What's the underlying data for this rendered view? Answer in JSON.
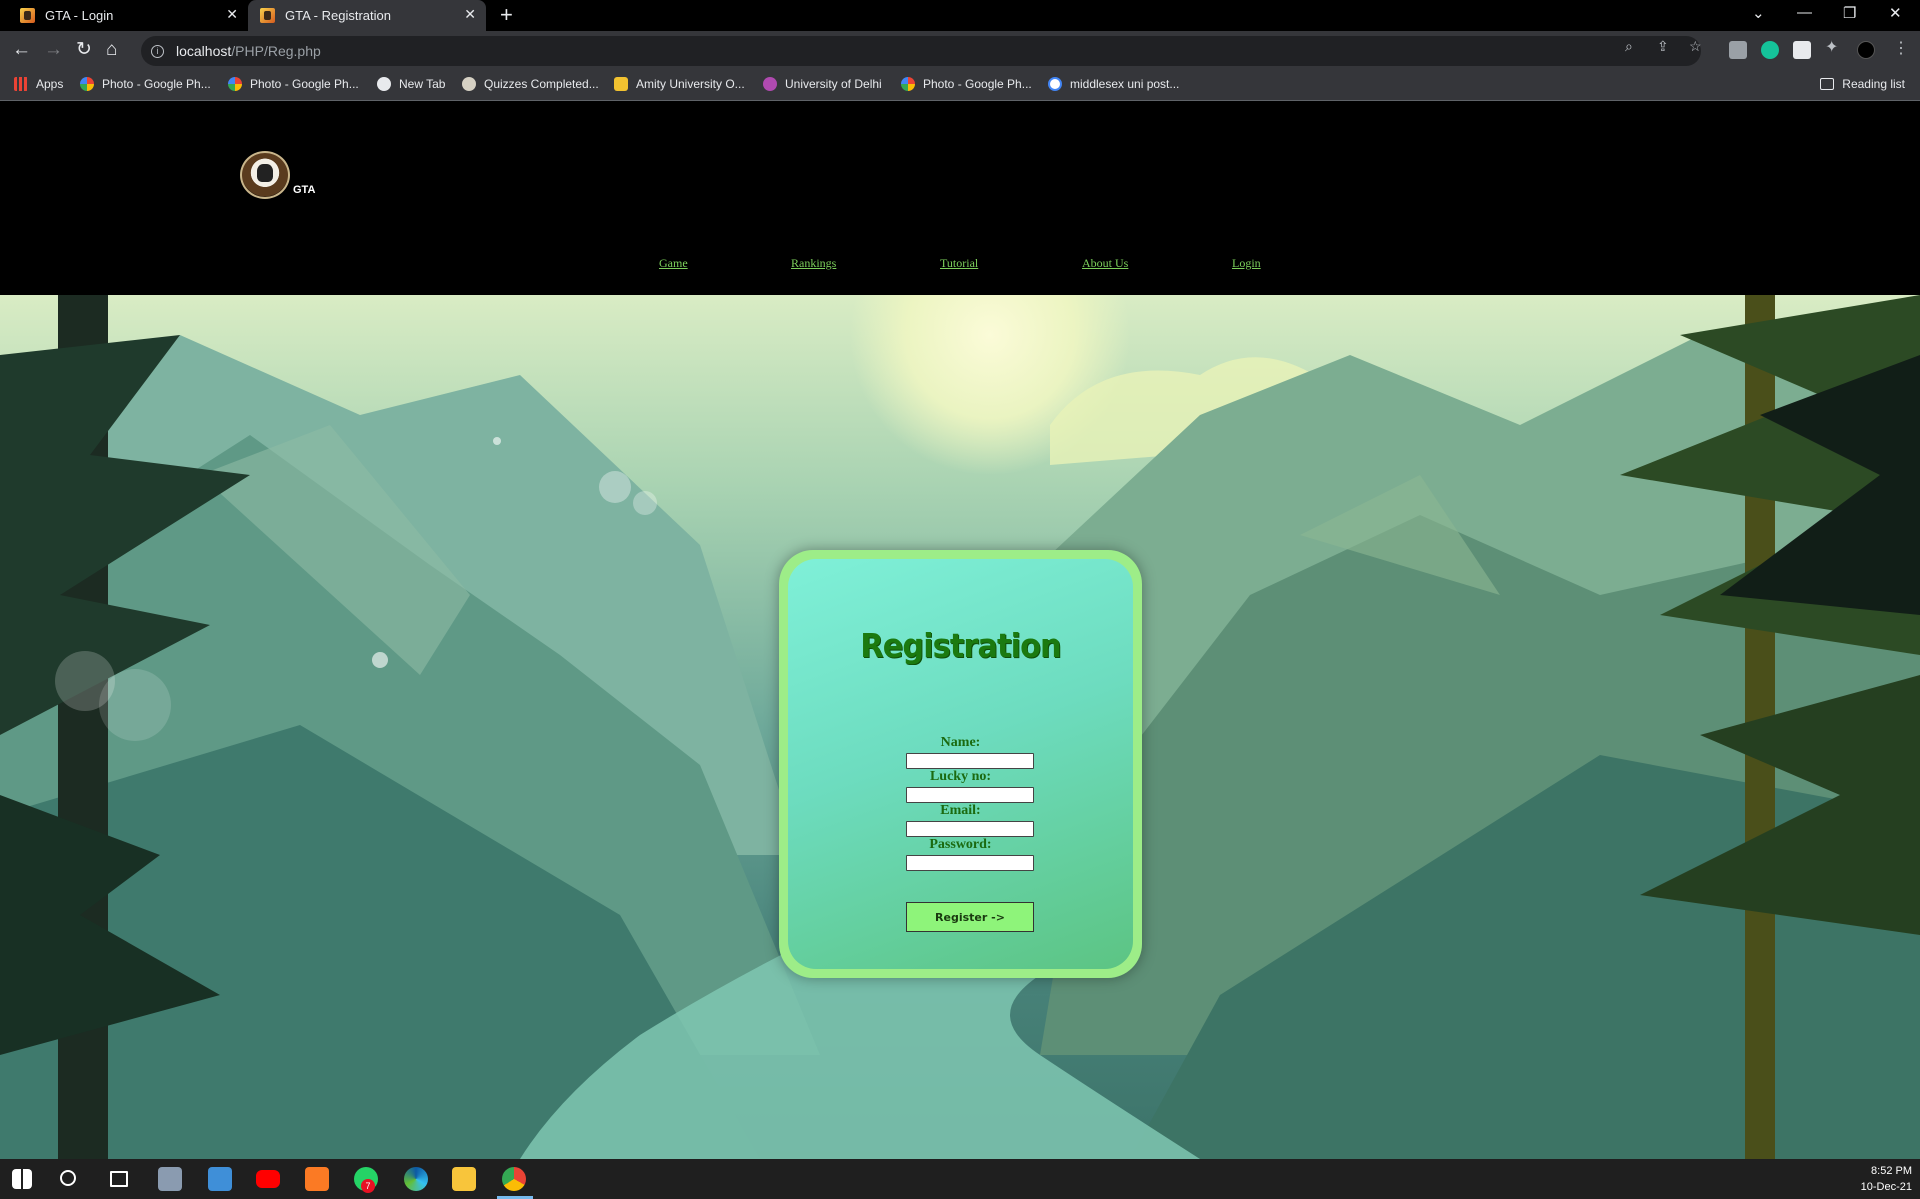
{
  "browser": {
    "tabs": [
      {
        "title": "GTA - Login"
      },
      {
        "title": "GTA - Registration"
      }
    ],
    "new_tab": "+",
    "url_host": "localhost",
    "url_path": "/PHP/Reg.php",
    "bookmarks": [
      {
        "label": "Apps",
        "icon": "apps-grid-icon"
      },
      {
        "label": "Photo - Google Ph...",
        "icon": "google-photos-icon"
      },
      {
        "label": "Photo - Google Ph...",
        "icon": "google-photos-icon"
      },
      {
        "label": "New Tab",
        "icon": "globe-icon"
      },
      {
        "label": "Quizzes Completed...",
        "icon": "quiz-icon"
      },
      {
        "label": "Amity University O...",
        "icon": "amity-icon"
      },
      {
        "label": "University of Delhi",
        "icon": "du-icon"
      },
      {
        "label": "Photo - Google Ph...",
        "icon": "google-photos-icon"
      },
      {
        "label": "middlesex uni post...",
        "icon": "google-icon"
      }
    ],
    "reading_list": "Reading list"
  },
  "site": {
    "logo_text": "GTA",
    "nav": [
      "Game",
      "Rankings",
      "Tutorial",
      "About Us",
      "Login"
    ],
    "nav_color": "#7cd05b"
  },
  "form": {
    "title": "Registration",
    "fields": [
      {
        "label": "Name:",
        "value": ""
      },
      {
        "label": "Lucky no:",
        "value": ""
      },
      {
        "label": "Email:",
        "value": ""
      },
      {
        "label": "Password:",
        "value": ""
      }
    ],
    "submit": "Register ->"
  },
  "taskbar": {
    "time": "8:52 PM",
    "date": "10-Dec-21",
    "whatsapp_badge": "7"
  }
}
